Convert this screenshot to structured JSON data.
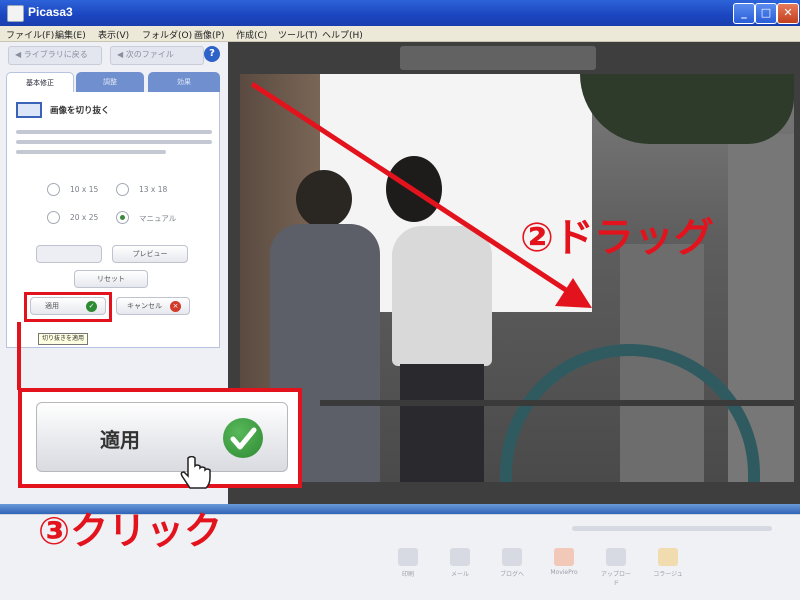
{
  "window": {
    "title": "Picasa3",
    "minimize": "_",
    "maximize": "□",
    "close": "✕"
  },
  "menu": [
    "ファイル(F)",
    "編集(E)",
    "表示(V)",
    "フォルダ(O)",
    "画像(P)",
    "作成(C)",
    "ツール(T)",
    "ヘルプ(H)"
  ],
  "nav": {
    "back": "ライブラリに戻る",
    "forward": "次のファイル",
    "help": "?"
  },
  "tabs": [
    "基本修正",
    "調整",
    "効果"
  ],
  "crop": {
    "title": "画像を切り抜く"
  },
  "radios": [
    {
      "label": "10 x 15",
      "selected": false
    },
    {
      "label": "13 x 18",
      "selected": false
    },
    {
      "label": "20 x 25",
      "selected": false
    },
    {
      "label": "マニュアル",
      "selected": true
    }
  ],
  "buttons": {
    "preview": "プレビュー",
    "reset": "リセット",
    "apply": "適用",
    "cancel": "キャンセル"
  },
  "tooltip": "切り抜きを適用",
  "callout": {
    "apply_label": "適用"
  },
  "annotations": {
    "drag": "②ドラッグ",
    "click": "③クリック"
  },
  "toolbar": [
    "印刷",
    "メール",
    "ブログへ",
    "MoviePro",
    "アップロード",
    "コラージュ"
  ],
  "colors": {
    "annotation_red": "#e3131d",
    "titlebar_blue": "#1b45c0",
    "check_green": "#2e8a33"
  }
}
